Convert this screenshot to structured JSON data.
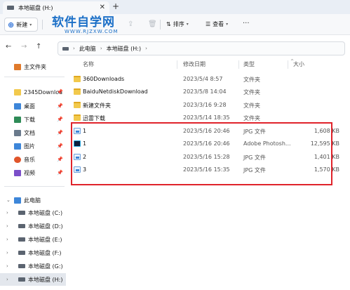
{
  "tab": {
    "title": "本地磁盘 (H:)",
    "close": "✕",
    "new_tab": "+"
  },
  "toolbar": {
    "new_label": "新建",
    "sort_label": "排序",
    "view_label": "查看",
    "more": "···"
  },
  "watermark": {
    "cn": "软件自学网",
    "en": "WWW.RJZXW.COM"
  },
  "breadcrumb": [
    "此电脑",
    "本地磁盘 (H:)"
  ],
  "sidebar": {
    "home": "主文件夹",
    "pinned": [
      {
        "label": "2345Downloa",
        "icon": "folder-icon",
        "color": "#f2c94c"
      },
      {
        "label": "桌面",
        "icon": "desktop-icon",
        "color": "#3d86d9"
      },
      {
        "label": "下载",
        "icon": "download-icon",
        "color": "#2e8b57"
      },
      {
        "label": "文档",
        "icon": "documents-icon",
        "color": "#6a7a8c"
      },
      {
        "label": "图片",
        "icon": "pictures-icon",
        "color": "#3d86d9"
      },
      {
        "label": "音乐",
        "icon": "music-icon",
        "color": "#e0552b"
      },
      {
        "label": "视频",
        "icon": "videos-icon",
        "color": "#7b4fc9"
      }
    ],
    "this_pc": "此电脑",
    "drives": [
      "本地磁盘 (C:)",
      "本地磁盘 (D:)",
      "本地磁盘 (E:)",
      "本地磁盘 (F:)",
      "本地磁盘 (G:)",
      "本地磁盘 (H:)"
    ]
  },
  "columns": {
    "name": "名称",
    "date": "修改日期",
    "type": "类型",
    "size": "大小"
  },
  "files": [
    {
      "name": "360Downloads",
      "date": "2023/5/4 8:57",
      "type": "文件夹",
      "size": "",
      "icon": "folder"
    },
    {
      "name": "BaiduNetdiskDownload",
      "date": "2023/5/8 14:04",
      "type": "文件夹",
      "size": "",
      "icon": "folder"
    },
    {
      "name": "新建文件夹",
      "date": "2023/3/16 9:28",
      "type": "文件夹",
      "size": "",
      "icon": "folder"
    },
    {
      "name": "迅雷下载",
      "date": "2023/5/14 18:35",
      "type": "文件夹",
      "size": "",
      "icon": "folder"
    },
    {
      "name": "1",
      "date": "2023/5/16 20:46",
      "type": "JPG 文件",
      "size": "1,608 KB",
      "icon": "jpg"
    },
    {
      "name": "1",
      "date": "2023/5/16 20:46",
      "type": "Adobe Photosh...",
      "size": "12,595 KB",
      "icon": "ps"
    },
    {
      "name": "2",
      "date": "2023/5/16 15:28",
      "type": "JPG 文件",
      "size": "1,401 KB",
      "icon": "jpg"
    },
    {
      "name": "3",
      "date": "2023/5/16 15:35",
      "type": "JPG 文件",
      "size": "1,570 KB",
      "icon": "jpg"
    }
  ],
  "colors": {
    "accent": "#2b6fd6",
    "highlight_box": "#e0232b",
    "selected": "#e3e7ed"
  }
}
